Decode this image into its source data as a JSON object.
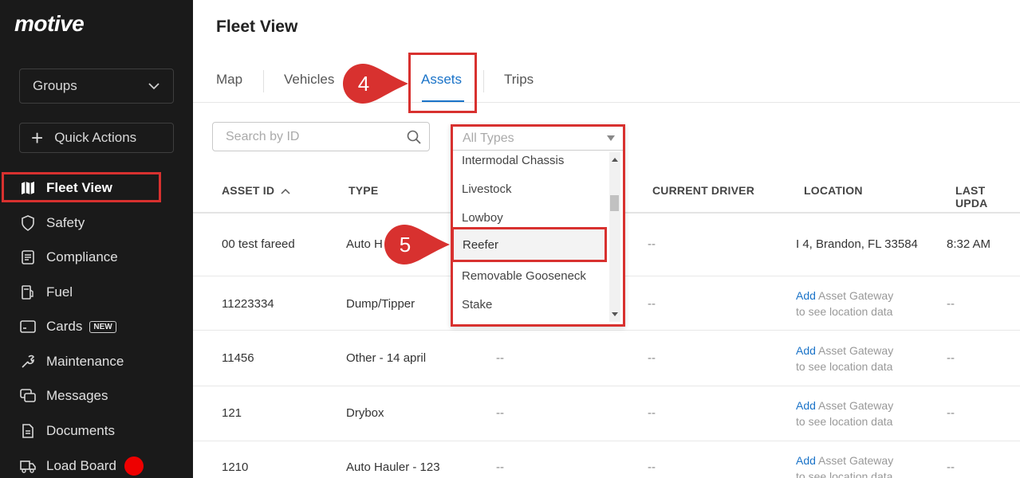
{
  "sidebar": {
    "logo": "motive",
    "groups_label": "Groups",
    "quick_actions_label": "Quick Actions",
    "nav": [
      {
        "label": "Fleet View",
        "icon": "map-icon",
        "active": true
      },
      {
        "label": "Safety",
        "icon": "shield-icon"
      },
      {
        "label": "Compliance",
        "icon": "list-icon"
      },
      {
        "label": "Fuel",
        "icon": "fuel-pump-icon"
      },
      {
        "label": "Cards",
        "icon": "card-icon",
        "badge": "NEW"
      },
      {
        "label": "Maintenance",
        "icon": "wrench-icon"
      },
      {
        "label": "Messages",
        "icon": "chat-icon"
      },
      {
        "label": "Documents",
        "icon": "document-icon"
      },
      {
        "label": "Load Board",
        "icon": "truck-icon"
      }
    ]
  },
  "header": {
    "title": "Fleet View"
  },
  "tabs": [
    {
      "label": "Map"
    },
    {
      "label": "Vehicles"
    },
    {
      "label": "Assets",
      "active": true
    },
    {
      "label": "Trips"
    }
  ],
  "search": {
    "placeholder": "Search by ID"
  },
  "type_filter": {
    "selected": "All Types",
    "options": [
      "Intermodal Chassis",
      "Livestock",
      "Lowboy",
      "Reefer",
      "Removable Gooseneck",
      "Stake"
    ],
    "highlighted": "Reefer"
  },
  "table": {
    "columns": [
      "ASSET ID",
      "TYPE",
      "CURRENT DRIVER",
      "LOCATION",
      "LAST UPDA"
    ],
    "rows": [
      {
        "id": "00 test fareed",
        "type": "Auto H",
        "col3": "",
        "driver": "--",
        "location": "I 4, Brandon, FL 33584",
        "updated": "8:32 AM"
      },
      {
        "id": "11223334",
        "type": "Dump/Tipper",
        "col3": "",
        "driver": "--",
        "loc_link": "Add",
        "loc_rest": " Asset Gateway",
        "loc_line2": "to see location data",
        "updated": "--"
      },
      {
        "id": "11456",
        "type": "Other - 14 april",
        "col3": "--",
        "driver": "--",
        "loc_link": "Add",
        "loc_rest": " Asset Gateway",
        "loc_line2": "to see location data",
        "updated": "--"
      },
      {
        "id": "121",
        "type": "Drybox",
        "col3": "--",
        "driver": "--",
        "loc_link": "Add",
        "loc_rest": " Asset Gateway",
        "loc_line2": "to see location data",
        "updated": "--"
      },
      {
        "id": "1210",
        "type": "Auto Hauler - 123",
        "col3": "--",
        "driver": "--",
        "loc_link": "Add",
        "loc_rest": " Asset Gateway",
        "loc_line2": "to see location data",
        "updated": "--"
      }
    ]
  },
  "annotations": {
    "step4": "4",
    "step5": "5",
    "highlight_color": "#d8312f"
  }
}
